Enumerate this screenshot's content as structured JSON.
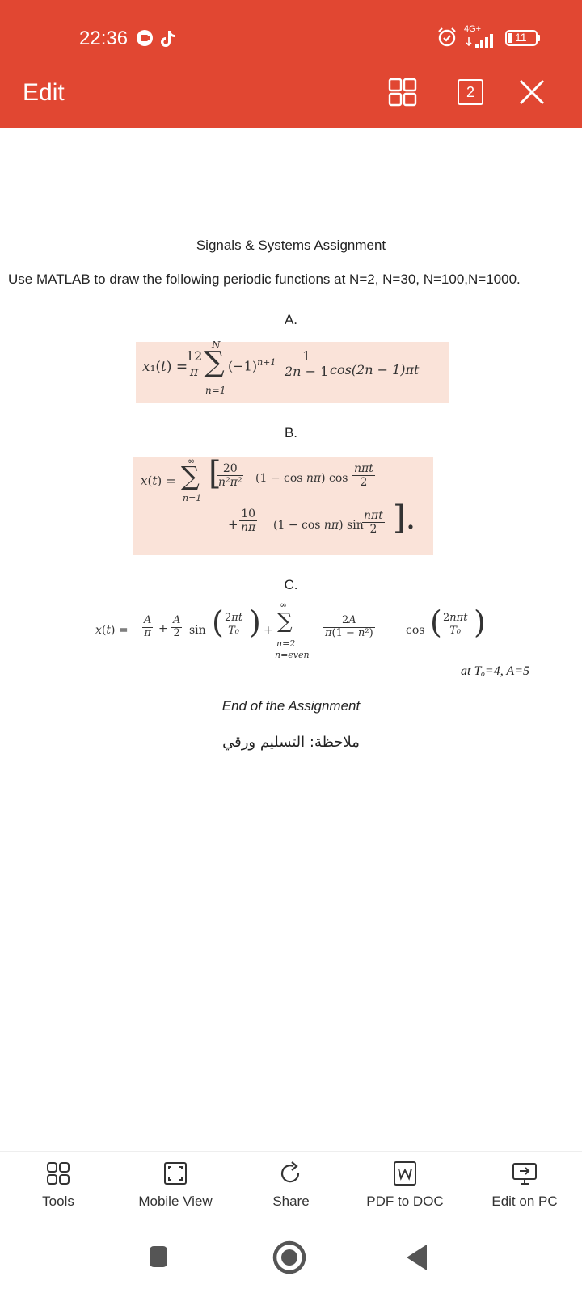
{
  "status_bar": {
    "time": "22:36",
    "network": "4G+",
    "battery": "11"
  },
  "app_bar": {
    "title": "Edit",
    "page_count": "2",
    "icons": [
      "grid-view-icon",
      "page-count-icon",
      "close-icon"
    ]
  },
  "document": {
    "title": "Signals & Systems Assignment",
    "instruction": "Use MATLAB to draw the following periodic functions at N=2, N=30, N=100,N=1000.",
    "part_a_label": "A.",
    "part_b_label": "B.",
    "part_c_label": "C.",
    "condition": "at Tₒ=4, A=5",
    "end_text": "End of the Assignment",
    "note": "ملاحظة: التسليم ورقي",
    "colors": {
      "equation_bg": "#fae3d9"
    }
  },
  "toolbar": {
    "items": [
      {
        "label": "Tools",
        "icon": "tools-grid-icon"
      },
      {
        "label": "Mobile View",
        "icon": "mobile-view-icon"
      },
      {
        "label": "Share",
        "icon": "share-icon"
      },
      {
        "label": "PDF to DOC",
        "icon": "word-doc-icon"
      },
      {
        "label": "Edit on PC",
        "icon": "edit-on-pc-icon"
      }
    ]
  },
  "colors": {
    "accent": "#e14732"
  }
}
